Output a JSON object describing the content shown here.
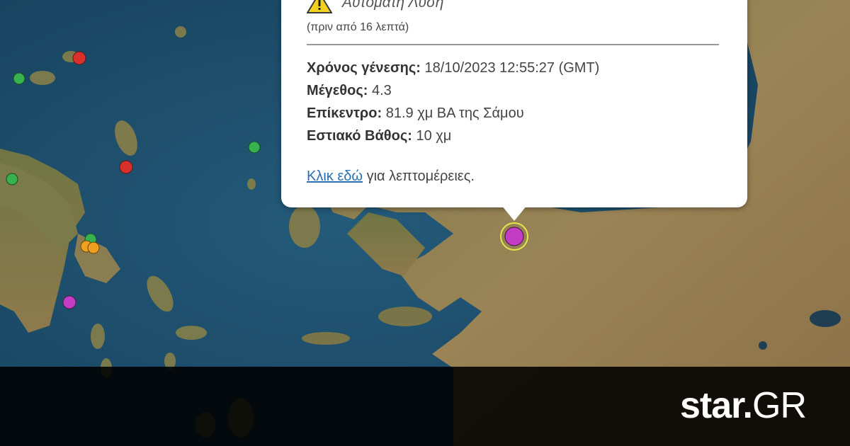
{
  "popup": {
    "title": "Αυτόματη Λύση",
    "ago": "(πριν από 16 λεπτά)",
    "fields": [
      {
        "label": "Χρόνος γένεσης:",
        "value": "18/10/2023 12:55:27 (GMT)"
      },
      {
        "label": "Μέγεθος:",
        "value": "4.3"
      },
      {
        "label": "Επίκεντρο:",
        "value": "81.9 χμ ΒΑ της Σάμου"
      },
      {
        "label": "Εστιακό Βάθος:",
        "value": "10 χμ"
      }
    ],
    "link_text": "Κλικ εδώ",
    "link_suffix": "για λεπτομέρειες.",
    "icon": "warning-triangle-icon"
  },
  "logo": {
    "name": "star",
    "suffix": "GR"
  },
  "markers": [
    {
      "color": "#d9302a",
      "label": "red"
    },
    {
      "color": "#d9302a",
      "label": "red"
    },
    {
      "color": "#37b24d",
      "label": "green"
    },
    {
      "color": "#37b24d",
      "label": "green"
    },
    {
      "color": "#37b24d",
      "label": "green"
    },
    {
      "color": "#37b24d",
      "label": "green"
    },
    {
      "color": "#f0a020",
      "label": "orange"
    },
    {
      "color": "#f0a020",
      "label": "orange"
    },
    {
      "color": "#c43cc4",
      "label": "magenta"
    },
    {
      "color": "#c43cc4",
      "label": "magenta-selected"
    }
  ],
  "colors": {
    "sea": "#1d4f6e",
    "land": "#8a7a4e",
    "popup_bg": "#ffffff",
    "link": "#2a6fb5"
  }
}
